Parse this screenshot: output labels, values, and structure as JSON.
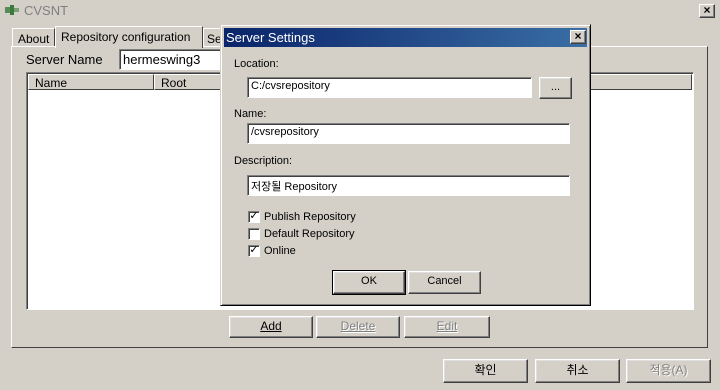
{
  "window": {
    "title": "CVSNT",
    "close_symbol": "×"
  },
  "tabs": [
    {
      "label": "About"
    },
    {
      "label": "Repository configuration"
    },
    {
      "label": "Se"
    }
  ],
  "server": {
    "label": "Server Name",
    "value": "hermeswing3"
  },
  "list": {
    "columns": [
      "Name",
      "Root"
    ]
  },
  "panel_buttons": {
    "add": "Add",
    "delete": "Delete",
    "edit": "Edit"
  },
  "footer_buttons": {
    "ok": "확인",
    "cancel": "취소",
    "apply": "적용(A)"
  },
  "dialog": {
    "title": "Server Settings",
    "close_symbol": "×",
    "location_label": "Location:",
    "location_value": "C:/cvsrepository",
    "browse_label": "...",
    "name_label": "Name:",
    "name_value": "/cvsrepository",
    "description_label": "Description:",
    "description_value": "저장될 Repository",
    "checkboxes": [
      {
        "label": "Publish Repository",
        "checked": true
      },
      {
        "label": "Default Repository",
        "checked": false
      },
      {
        "label": "Online",
        "checked": true
      }
    ],
    "check_mark": "✓",
    "ok_label": "OK",
    "cancel_label": "Cancel"
  }
}
